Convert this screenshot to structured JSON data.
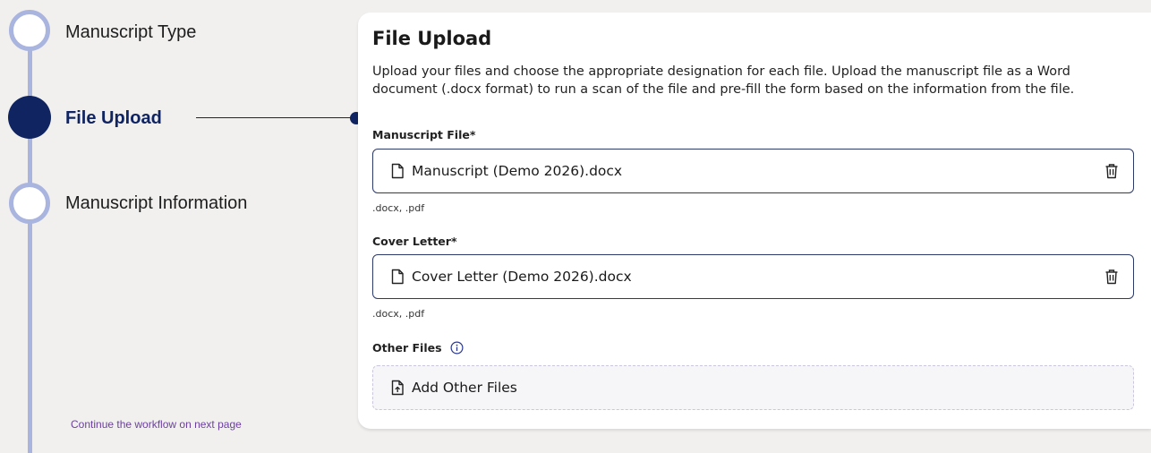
{
  "steps": [
    {
      "label": "Manuscript Type",
      "state": "done"
    },
    {
      "label": "File Upload",
      "state": "active"
    },
    {
      "label": "Manuscript Information",
      "state": "pending"
    }
  ],
  "continue_text": "Continue the workflow on next page",
  "panel": {
    "title": "File Upload",
    "description": "Upload your files and choose the appropriate designation for each file. Upload the manuscript file as a Word document (.docx format) to run a scan of the file and pre-fill the form based on the information from the file.",
    "manuscript": {
      "label": "Manuscript File*",
      "file_name": "Manuscript (Demo 2026).docx",
      "formats": ".docx, .pdf"
    },
    "cover_letter": {
      "label": "Cover Letter*",
      "file_name": "Cover Letter (Demo 2026).docx",
      "formats": ".docx, .pdf"
    },
    "other_files": {
      "label": "Other Files",
      "add_label": "Add Other Files"
    }
  },
  "icons": {
    "file": "document-icon",
    "delete": "trash-icon",
    "info": "info-icon",
    "add": "upload-icon"
  },
  "colors": {
    "active_step": "#0f2460",
    "rail": "#a9b4df",
    "link": "#6b3fa0",
    "border": "#2c3a6b"
  }
}
